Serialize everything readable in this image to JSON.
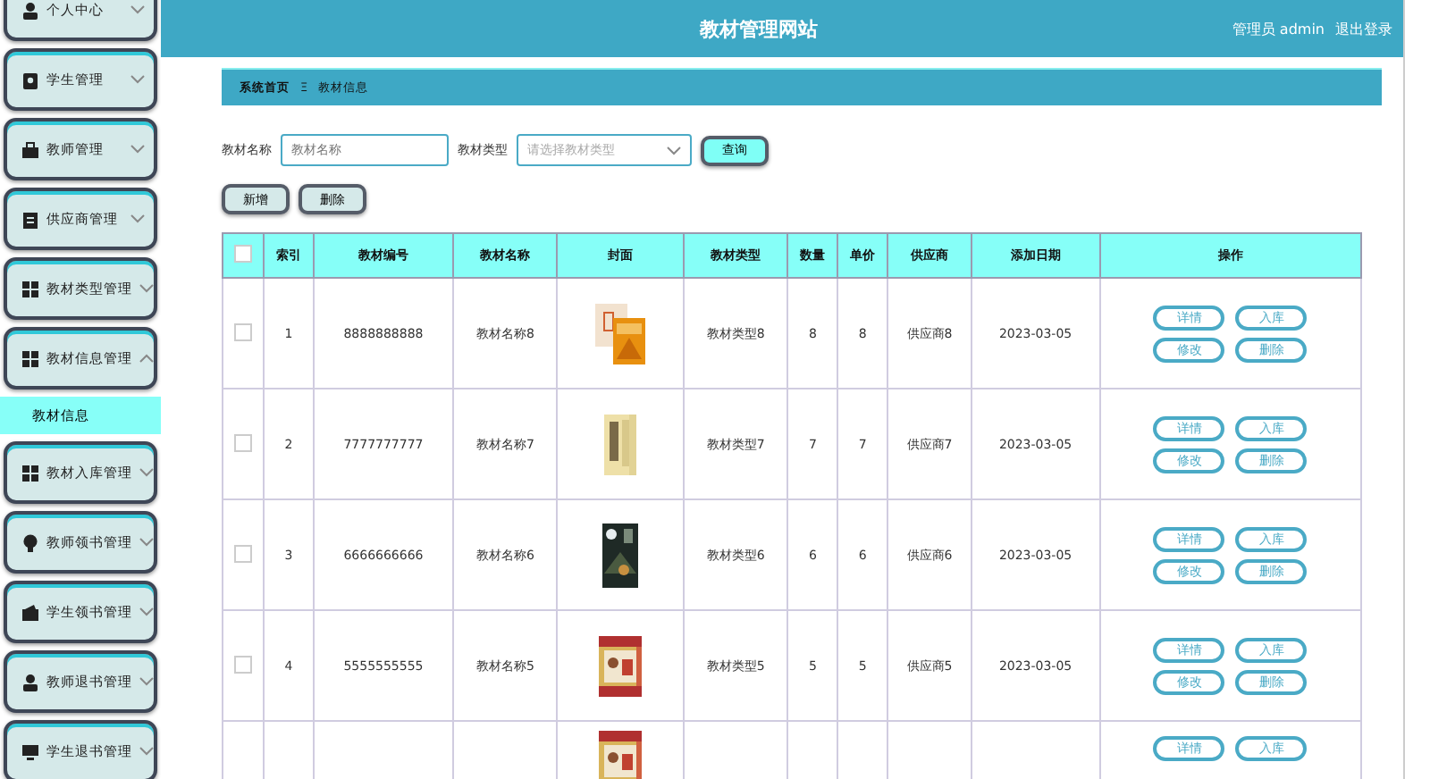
{
  "sidebar": {
    "items": [
      {
        "label": "个人中心",
        "expanded": false
      },
      {
        "label": "学生管理",
        "expanded": false
      },
      {
        "label": "教师管理",
        "expanded": false
      },
      {
        "label": "供应商管理",
        "expanded": false
      },
      {
        "label": "教材类型管理",
        "expanded": false
      },
      {
        "label": "教材信息管理",
        "expanded": true,
        "children": [
          {
            "label": "教材信息",
            "selected": true
          }
        ]
      },
      {
        "label": "教材入库管理",
        "expanded": false
      },
      {
        "label": "教师领书管理",
        "expanded": false
      },
      {
        "label": "学生领书管理",
        "expanded": false
      },
      {
        "label": "教师退书管理",
        "expanded": false
      },
      {
        "label": "学生退书管理",
        "expanded": false
      }
    ]
  },
  "header": {
    "title": "教材管理网站",
    "user": "管理员 admin",
    "logout": "退出登录"
  },
  "breadcrumb": {
    "home": "系统首页",
    "separator": "Ξ",
    "current": "教材信息"
  },
  "search": {
    "name_label": "教材名称",
    "name_placeholder": "教材名称",
    "type_label": "教材类型",
    "type_placeholder": "请选择教材类型",
    "button": "查询"
  },
  "actions": [
    "新增",
    "删除"
  ],
  "table": {
    "columns": [
      "索引",
      "教材编号",
      "教材名称",
      "封面",
      "教材类型",
      "数量",
      "单价",
      "供应商",
      "添加日期",
      "操作"
    ],
    "header_checked": false,
    "rows": [
      {
        "checked": false,
        "cells": [
          "1",
          "8888888888",
          "教材名称8",
          null,
          "教材类型8",
          "8",
          "8",
          "供应商8",
          "2023-03-05"
        ],
        "actions": [
          "详情",
          "入库",
          "修改",
          "删除"
        ]
      },
      {
        "checked": false,
        "cells": [
          "2",
          "7777777777",
          "教材名称7",
          null,
          "教材类型7",
          "7",
          "7",
          "供应商7",
          "2023-03-05"
        ],
        "actions": [
          "详情",
          "入库",
          "修改",
          "删除"
        ]
      },
      {
        "checked": false,
        "cells": [
          "3",
          "6666666666",
          "教材名称6",
          null,
          "教材类型6",
          "6",
          "6",
          "供应商6",
          "2023-03-05"
        ],
        "actions": [
          "详情",
          "入库",
          "修改",
          "删除"
        ]
      },
      {
        "checked": false,
        "cells": [
          "4",
          "5555555555",
          "教材名称5",
          null,
          "教材类型5",
          "5",
          "5",
          "供应商5",
          "2023-03-05"
        ],
        "actions": [
          "详情",
          "入库",
          "修改",
          "删除"
        ]
      },
      {
        "actions": [
          "详情",
          "入库"
        ]
      }
    ]
  }
}
